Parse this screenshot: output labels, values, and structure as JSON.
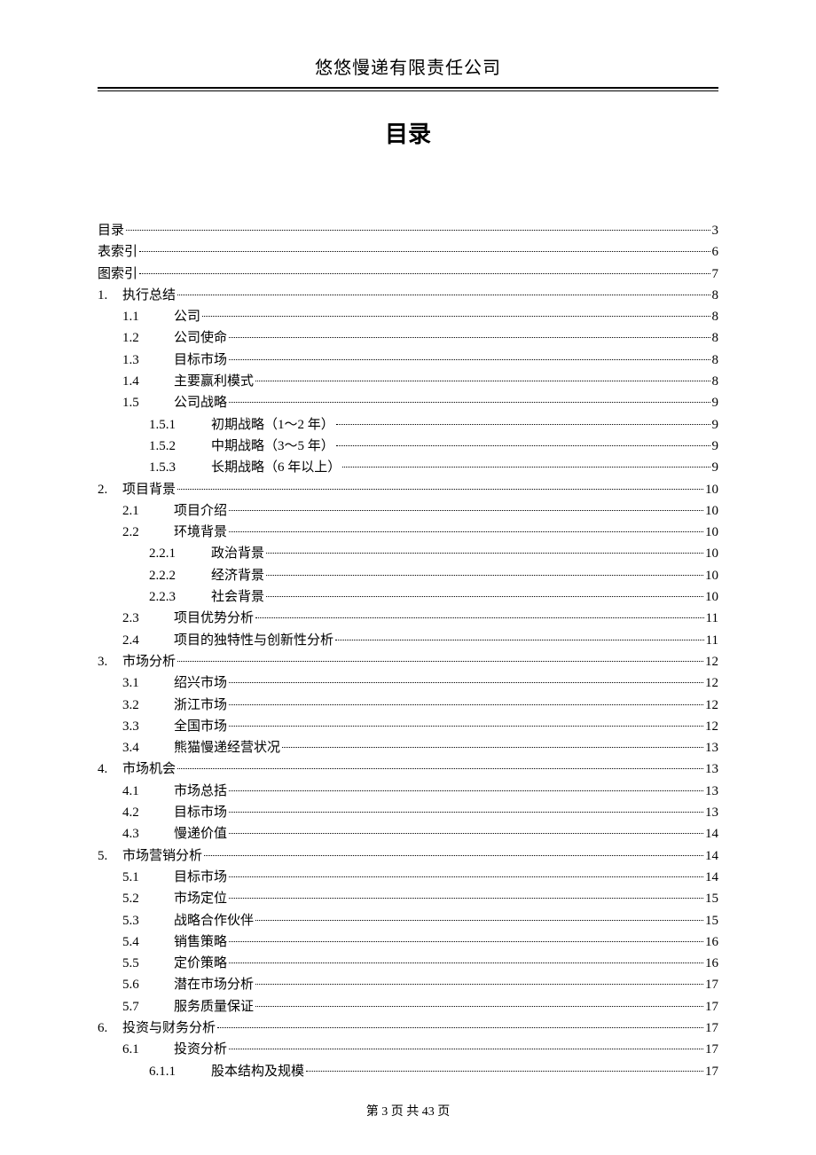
{
  "header": "悠悠慢递有限责任公司",
  "title": "目录",
  "footer": "第 3 页 共 43 页",
  "toc": [
    {
      "level": "top",
      "num": "",
      "label": "目录",
      "page": "3"
    },
    {
      "level": "top",
      "num": "",
      "label": "表索引",
      "page": "6"
    },
    {
      "level": "top",
      "num": "",
      "label": "图索引",
      "page": "7"
    },
    {
      "level": "1",
      "num": "1.",
      "label": "执行总结",
      "page": "8"
    },
    {
      "level": "2",
      "num": "1.1",
      "label": "公司",
      "page": "8"
    },
    {
      "level": "2",
      "num": "1.2",
      "label": "公司使命",
      "page": "8"
    },
    {
      "level": "2",
      "num": "1.3",
      "label": "目标市场",
      "page": "8"
    },
    {
      "level": "2",
      "num": "1.4",
      "label": "主要赢利模式",
      "page": "8"
    },
    {
      "level": "2",
      "num": "1.5",
      "label": "公司战略",
      "page": "9"
    },
    {
      "level": "3",
      "num": "1.5.1",
      "label": "初期战略（1～2 年）",
      "page": "9"
    },
    {
      "level": "3",
      "num": "1.5.2",
      "label": "中期战略（3～5 年）",
      "page": "9"
    },
    {
      "level": "3",
      "num": "1.5.3",
      "label": "长期战略（6 年以上）",
      "page": "9"
    },
    {
      "level": "1",
      "num": "2.",
      "label": "项目背景",
      "page": "10"
    },
    {
      "level": "2",
      "num": "2.1",
      "label": "项目介绍",
      "page": "10"
    },
    {
      "level": "2",
      "num": "2.2",
      "label": "环境背景",
      "page": "10"
    },
    {
      "level": "3",
      "num": "2.2.1",
      "label": "政治背景",
      "page": "10"
    },
    {
      "level": "3",
      "num": "2.2.2",
      "label": "经济背景",
      "page": "10"
    },
    {
      "level": "3",
      "num": "2.2.3",
      "label": "社会背景",
      "page": "10"
    },
    {
      "level": "2",
      "num": "2.3",
      "label": "项目优势分析",
      "page": "11"
    },
    {
      "level": "2",
      "num": "2.4",
      "label": "项目的独特性与创新性分析",
      "page": "11"
    },
    {
      "level": "1",
      "num": "3.",
      "label": "市场分析",
      "page": "12"
    },
    {
      "level": "2",
      "num": "3.1",
      "label": "绍兴市场",
      "page": "12"
    },
    {
      "level": "2",
      "num": "3.2",
      "label": "浙江市场",
      "page": "12"
    },
    {
      "level": "2",
      "num": "3.3",
      "label": "全国市场",
      "page": "12"
    },
    {
      "level": "2",
      "num": "3.4",
      "label": "熊猫慢递经营状况",
      "page": "13"
    },
    {
      "level": "1",
      "num": "4.",
      "label": "市场机会",
      "page": "13"
    },
    {
      "level": "2",
      "num": "4.1",
      "label": "市场总括",
      "page": "13"
    },
    {
      "level": "2",
      "num": "4.2",
      "label": "目标市场",
      "page": "13"
    },
    {
      "level": "2",
      "num": "4.3",
      "label": "慢递价值",
      "page": "14"
    },
    {
      "level": "1",
      "num": "5.",
      "label": "市场营销分析",
      "page": "14"
    },
    {
      "level": "2",
      "num": "5.1",
      "label": "目标市场",
      "page": "14"
    },
    {
      "level": "2",
      "num": "5.2",
      "label": "市场定位",
      "page": "15"
    },
    {
      "level": "2",
      "num": "5.3",
      "label": "战略合作伙伴",
      "page": "15"
    },
    {
      "level": "2",
      "num": "5.4",
      "label": "销售策略",
      "page": "16"
    },
    {
      "level": "2",
      "num": "5.5",
      "label": "定价策略",
      "page": "16"
    },
    {
      "level": "2",
      "num": "5.6",
      "label": "潜在市场分析",
      "page": "17"
    },
    {
      "level": "2",
      "num": "5.7",
      "label": "服务质量保证",
      "page": "17"
    },
    {
      "level": "1",
      "num": "6.",
      "label": "投资与财务分析",
      "page": "17"
    },
    {
      "level": "2",
      "num": "6.1",
      "label": "投资分析",
      "page": "17"
    },
    {
      "level": "3",
      "num": "6.1.1",
      "label": "股本结构及规模",
      "page": "17"
    }
  ]
}
